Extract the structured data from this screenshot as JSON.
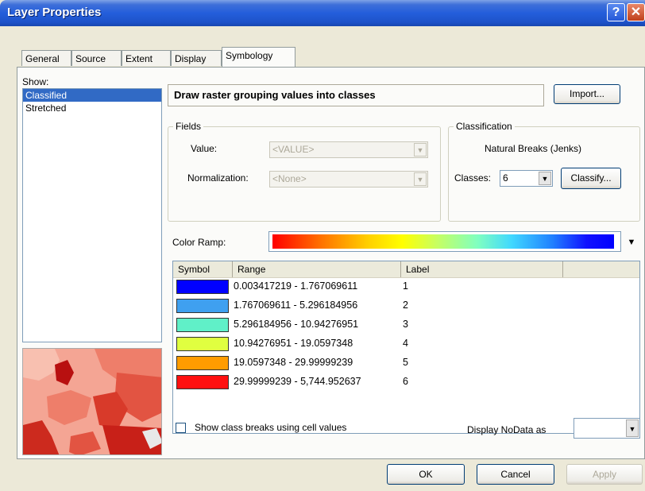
{
  "window": {
    "title": "Layer Properties",
    "help_glyph": "?",
    "close_glyph": "✕"
  },
  "tabs": [
    "General",
    "Source",
    "Extent",
    "Display",
    "Symbology"
  ],
  "show": {
    "label": "Show:",
    "items": [
      "Classified",
      "Stretched"
    ],
    "selected": "Classified"
  },
  "description": "Draw raster grouping values into classes",
  "import_label": "Import...",
  "fields": {
    "legend": "Fields",
    "value_label": "Value:",
    "value": "<VALUE>",
    "normalization_label": "Normalization:",
    "normalization": "<None>"
  },
  "classification": {
    "legend": "Classification",
    "method": "Natural Breaks (Jenks)",
    "classes_label": "Classes:",
    "classes_value": "6",
    "classify_label": "Classify..."
  },
  "color_ramp_label": "Color Ramp:",
  "table": {
    "headers": {
      "symbol": "Symbol",
      "range": "Range",
      "label": "Label"
    },
    "rows": [
      {
        "color": "#0000ff",
        "range": "0.003417219 - 1.767069611",
        "label": "1"
      },
      {
        "color": "#3fa0f0",
        "range": "1.767069611 - 5.296184956",
        "label": "2"
      },
      {
        "color": "#60f0c8",
        "range": "5.296184956 - 10.94276951",
        "label": "3"
      },
      {
        "color": "#e0ff40",
        "range": "10.94276951 - 19.0597348",
        "label": "4"
      },
      {
        "color": "#ff9c00",
        "range": "19.0597348 - 29.99999239",
        "label": "5"
      },
      {
        "color": "#ff1010",
        "range": "29.99999239 - 5,744.952637",
        "label": "6"
      }
    ]
  },
  "show_class_breaks_label": "Show class breaks using cell values",
  "nodata_label": "Display NoData as",
  "buttons": {
    "ok": "OK",
    "cancel": "Cancel",
    "apply": "Apply"
  }
}
